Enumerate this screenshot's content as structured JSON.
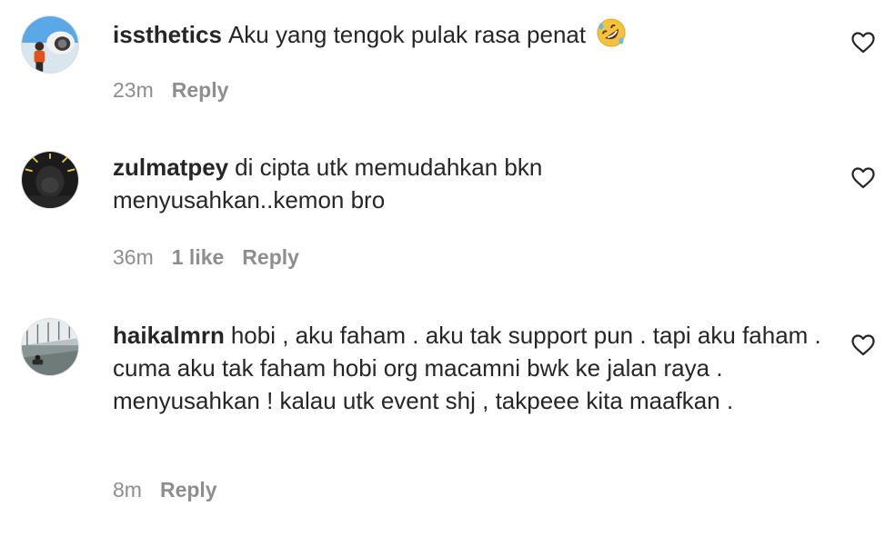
{
  "comments": [
    {
      "username": "issthetics",
      "text": "Aku yang tengok pulak rasa penat",
      "emoji": "rolling-on-floor-laughing-emoji",
      "time": "23m",
      "likes": "",
      "reply_label": "Reply"
    },
    {
      "username": "zulmatpey",
      "text": "di cipta utk memudahkan bkn menyusahkan..kemon bro",
      "time": "36m",
      "likes": "1 like",
      "reply_label": "Reply"
    },
    {
      "username": "haikalmrn",
      "text": "hobi , aku faham . aku tak support pun . tapi aku faham . cuma aku tak faham hobi org macamni bwk ke jalan raya . menyusahkan ! kalau utk event shj , takpeee kita maafkan .",
      "time": "8m",
      "likes": "",
      "reply_label": "Reply"
    }
  ],
  "colors": {
    "text": "#262626",
    "meta": "#8e8e8e",
    "background": "#ffffff"
  },
  "icons": {
    "like": "heart-outline-icon"
  }
}
